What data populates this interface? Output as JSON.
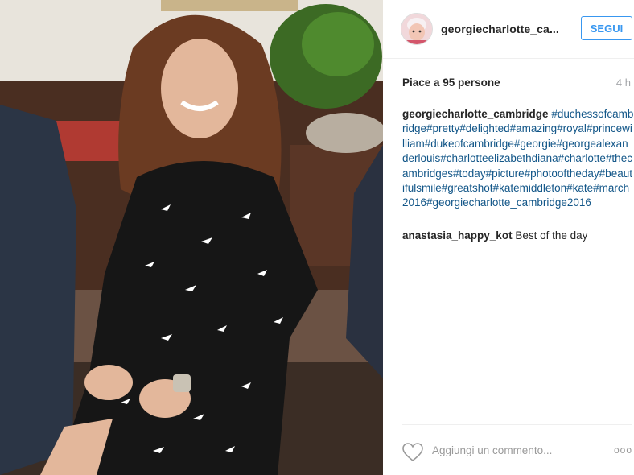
{
  "post": {
    "username": "georgiecharlotte_ca...",
    "follow_label": "SEGUI",
    "likes_text": "Piace a 95 persone",
    "time_ago": "4 h",
    "caption_user": "georgiecharlotte_cambridge",
    "caption_tags": "#duchessofcambridge#pretty#delighted#amazing#royal#princewilliam#dukeofcambridge#georgie#georgealexanderlouis#charlotteelizabethdiana#charlotte#thecambridges#today#picture#photooftheday#beautifulsmile#greatshot#katemiddleton#kate#march2016#georgiecharlotte_cambridge2016",
    "comments": [
      {
        "user": "anastasia_happy_kot",
        "text": "Best of the day"
      }
    ],
    "comment_placeholder": "Aggiungi un commento...",
    "more_label": "ooo"
  },
  "icons": {
    "heart": "heart-icon",
    "more": "more-options-icon",
    "avatar": "avatar"
  },
  "colors": {
    "follow": "#3897f0",
    "hashtag": "#125688",
    "muted": "#a5a7aa"
  }
}
